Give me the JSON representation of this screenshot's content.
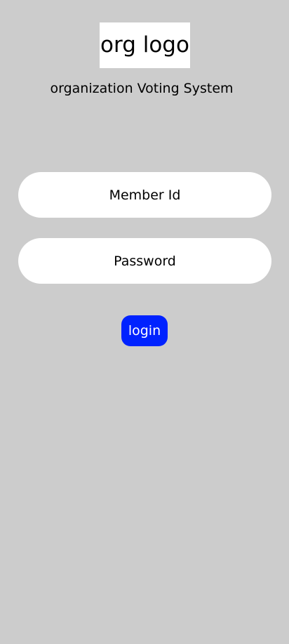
{
  "header": {
    "logo_text": "org logo",
    "subtitle": "organization Voting System"
  },
  "form": {
    "member_id_placeholder": "Member Id",
    "password_placeholder": "Password",
    "login_label": "login"
  },
  "colors": {
    "background": "#cccccc",
    "field_background": "#ffffff",
    "login_button": "#0022ff",
    "login_text": "#ffffff"
  }
}
